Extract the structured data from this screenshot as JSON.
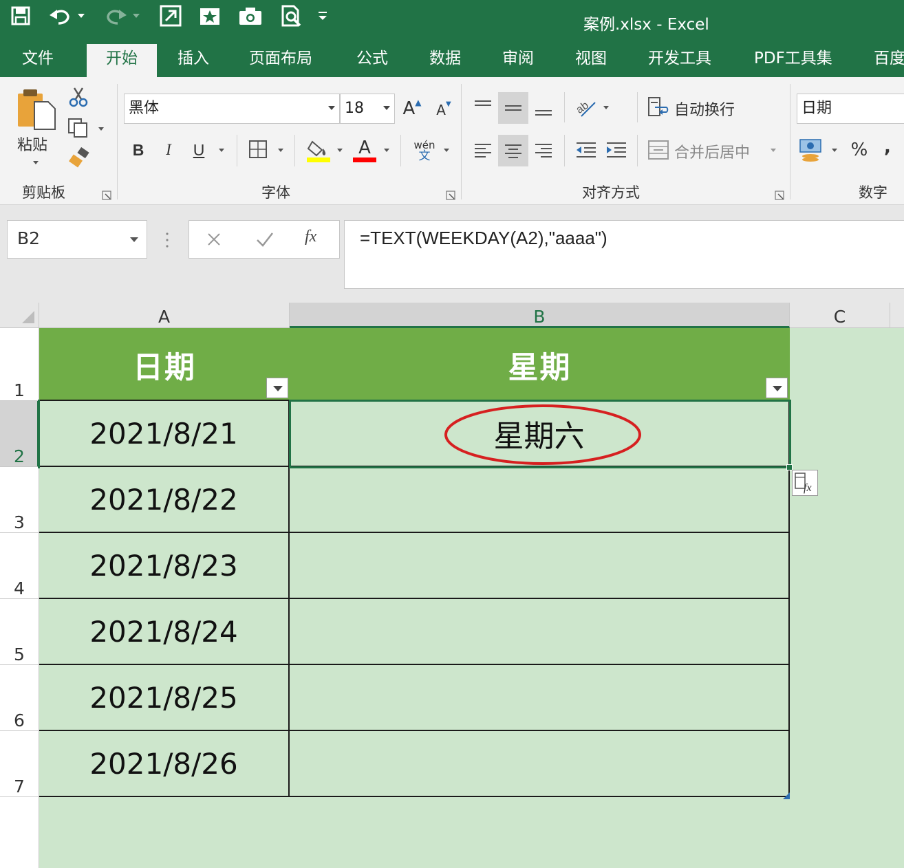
{
  "window": {
    "title": "案例.xlsx - Excel",
    "colors": {
      "brand": "#217346",
      "header_fill": "#70ad47",
      "table_fill": "#cde6cc",
      "annotation": "#d62020"
    }
  },
  "quick_access": [
    "save-icon",
    "undo-icon",
    "redo-icon",
    "insert-icon",
    "star-icon",
    "camera-icon",
    "preview-icon",
    "customize-icon"
  ],
  "tabs": [
    {
      "label": "文件"
    },
    {
      "label": "开始",
      "active": true
    },
    {
      "label": "插入"
    },
    {
      "label": "页面布局"
    },
    {
      "label": "公式"
    },
    {
      "label": "数据"
    },
    {
      "label": "审阅"
    },
    {
      "label": "视图"
    },
    {
      "label": "开发工具"
    },
    {
      "label": "PDF工具集"
    },
    {
      "label": "百度"
    }
  ],
  "ribbon": {
    "clipboard": {
      "paste_label": "粘贴",
      "group_label": "剪贴板"
    },
    "font": {
      "font_name": "黑体",
      "font_size": "18",
      "bold": "B",
      "italic": "I",
      "underline": "U",
      "font_color_letter": "A",
      "phonetic": "wén",
      "phonetic_sub": "文",
      "group_label": "字体"
    },
    "alignment": {
      "wrap_text": "自动换行",
      "merge_center": "合并后居中",
      "group_label": "对齐方式"
    },
    "number": {
      "format": "日期",
      "percent": "%",
      "comma": ",",
      "group_label": "数字"
    }
  },
  "formula_bar": {
    "name_box": "B2",
    "formula": "=TEXT(WEEKDAY(A2),\"aaaa\")",
    "fx": "fx"
  },
  "sheet": {
    "columns": [
      "A",
      "B",
      "C"
    ],
    "selected_column": "B",
    "row_numbers": [
      "1",
      "2",
      "3",
      "4",
      "5",
      "6",
      "7"
    ],
    "selected_row": "2",
    "header": {
      "col_a": "日期",
      "col_b": "星期"
    },
    "rows": [
      {
        "date": "2021/8/21",
        "weekday": "星期六"
      },
      {
        "date": "2021/8/22",
        "weekday": ""
      },
      {
        "date": "2021/8/23",
        "weekday": ""
      },
      {
        "date": "2021/8/24",
        "weekday": ""
      },
      {
        "date": "2021/8/25",
        "weekday": ""
      },
      {
        "date": "2021/8/26",
        "weekday": ""
      }
    ]
  }
}
